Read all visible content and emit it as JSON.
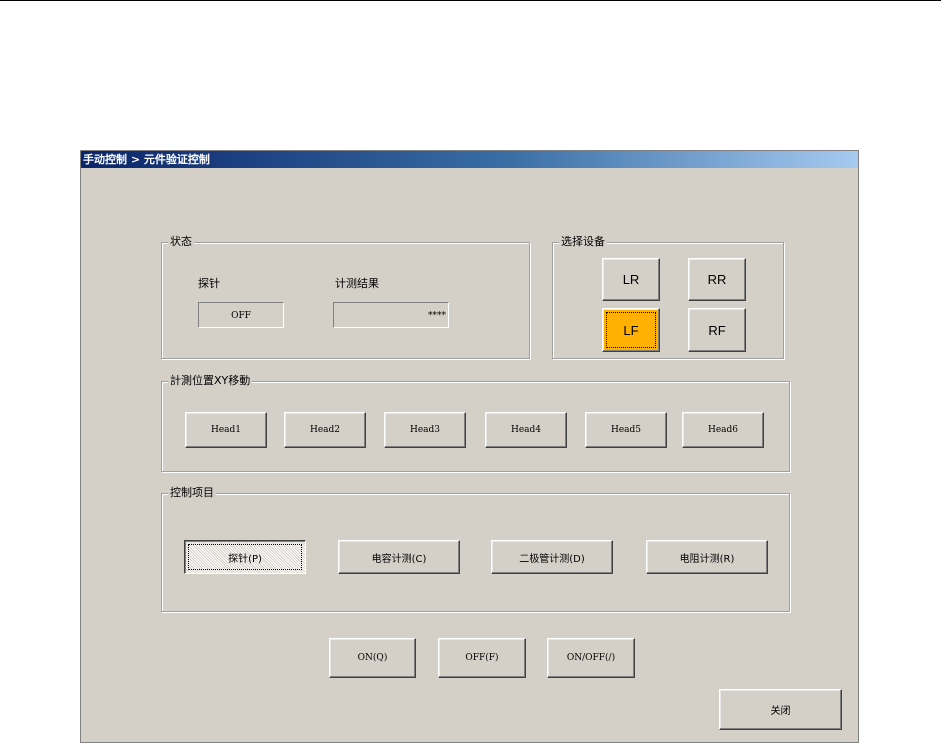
{
  "window": {
    "title": "手动控制 > 元件验证控制"
  },
  "status_group": {
    "legend": "状态",
    "probe_label": "探针",
    "probe_value": "OFF",
    "result_label": "计测结果",
    "result_value": "****"
  },
  "device_group": {
    "legend": "选择设备",
    "buttons": [
      "LR",
      "RR",
      "LF",
      "RF"
    ],
    "selected": "LF",
    "selected_color": "#ffb000"
  },
  "xy_group": {
    "legend": "計測位置XY移動",
    "heads": [
      "Head1",
      "Head2",
      "Head3",
      "Head4",
      "Head5",
      "Head6"
    ]
  },
  "control_group": {
    "legend": "控制项目",
    "items": [
      "探针(P)",
      "电容计测(C)",
      "二极管计测(D)",
      "电阻计测(R)"
    ],
    "selected": "探针(P)"
  },
  "actions": {
    "on": "ON(Q)",
    "off": "OFF(F)",
    "toggle": "ON/OFF(/)"
  },
  "close_label": "关闭"
}
